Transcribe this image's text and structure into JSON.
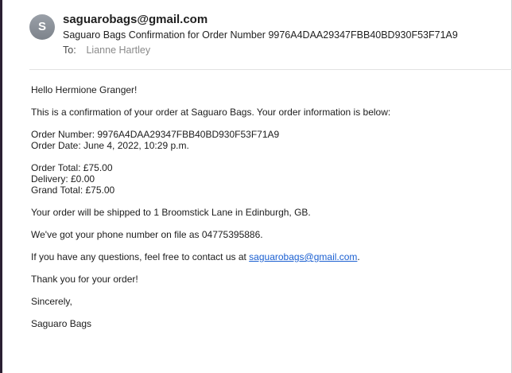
{
  "header": {
    "avatar_letter": "S",
    "from": "saguarobags@gmail.com",
    "subject": "Saguaro Bags Confirmation for Order Number 9976A4DAA29347FBB40BD930F53F71A9",
    "to_label": "To:",
    "to_value": "Lianne Hartley"
  },
  "message": {
    "greeting": "Hello Hermione Granger!",
    "intro": "This is a confirmation of your order at Saguaro Bags. Your order information is below:",
    "order_number": "Order Number: 9976A4DAA29347FBB40BD930F53F71A9",
    "order_date": "Order Date: June 4, 2022, 10:29 p.m.",
    "order_total": "Order Total: £75.00",
    "delivery": "Delivery: £0.00",
    "grand_total": "Grand Total: £75.00",
    "shipping": "Your order will be shipped to 1 Broomstick Lane in Edinburgh, GB.",
    "phone": "We've got your phone number on file as 04775395886.",
    "questions_prefix": "If you have any questions, feel free to contact us at ",
    "contact_email": "saguarobags@gmail.com",
    "questions_suffix": ".",
    "thanks": "Thank you for your order!",
    "signoff": "Sincerely,",
    "signature": "Saguaro Bags"
  }
}
